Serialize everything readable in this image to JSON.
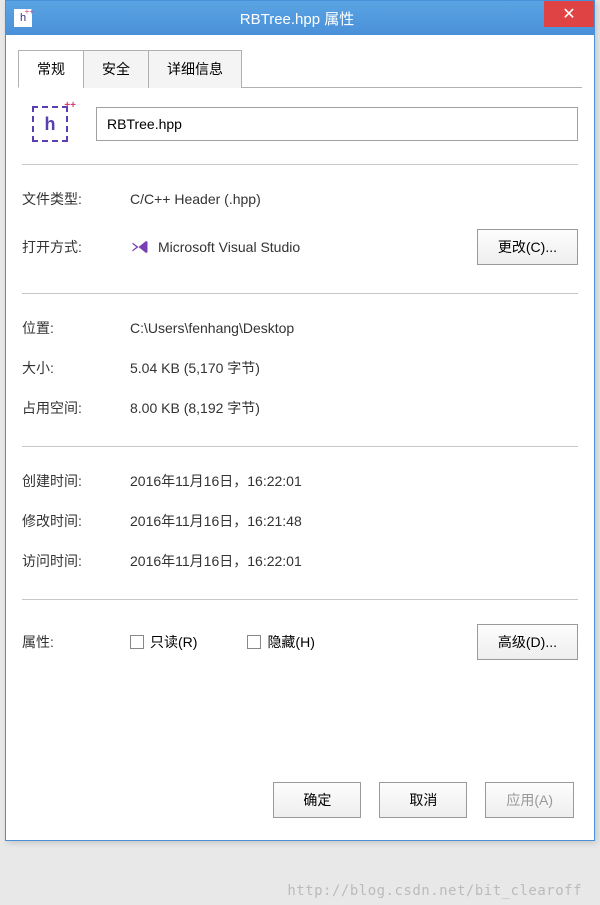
{
  "title": "RBTree.hpp 属性",
  "tabs": {
    "general": "常规",
    "security": "安全",
    "details": "详细信息"
  },
  "filename": "RBTree.hpp",
  "labels": {
    "filetype": "文件类型:",
    "opens_with": "打开方式:",
    "change_btn": "更改(C)...",
    "location": "位置:",
    "size": "大小:",
    "size_on_disk": "占用空间:",
    "created": "创建时间:",
    "modified": "修改时间:",
    "accessed": "访问时间:",
    "attributes": "属性:",
    "readonly": "只读(R)",
    "hidden": "隐藏(H)",
    "advanced_btn": "高级(D)..."
  },
  "values": {
    "filetype": "C/C++ Header (.hpp)",
    "opens_with": "Microsoft Visual Studio",
    "location": "C:\\Users\\fenhang\\Desktop",
    "size": "5.04 KB (5,170 字节)",
    "size_on_disk": "8.00 KB (8,192 字节)",
    "created": "2016年11月16日，16:22:01",
    "modified": "2016年11月16日，16:21:48",
    "accessed": "2016年11月16日，16:22:01"
  },
  "footer": {
    "ok": "确定",
    "cancel": "取消",
    "apply": "应用(A)"
  },
  "watermark": "http://blog.csdn.net/bit_clearoff"
}
